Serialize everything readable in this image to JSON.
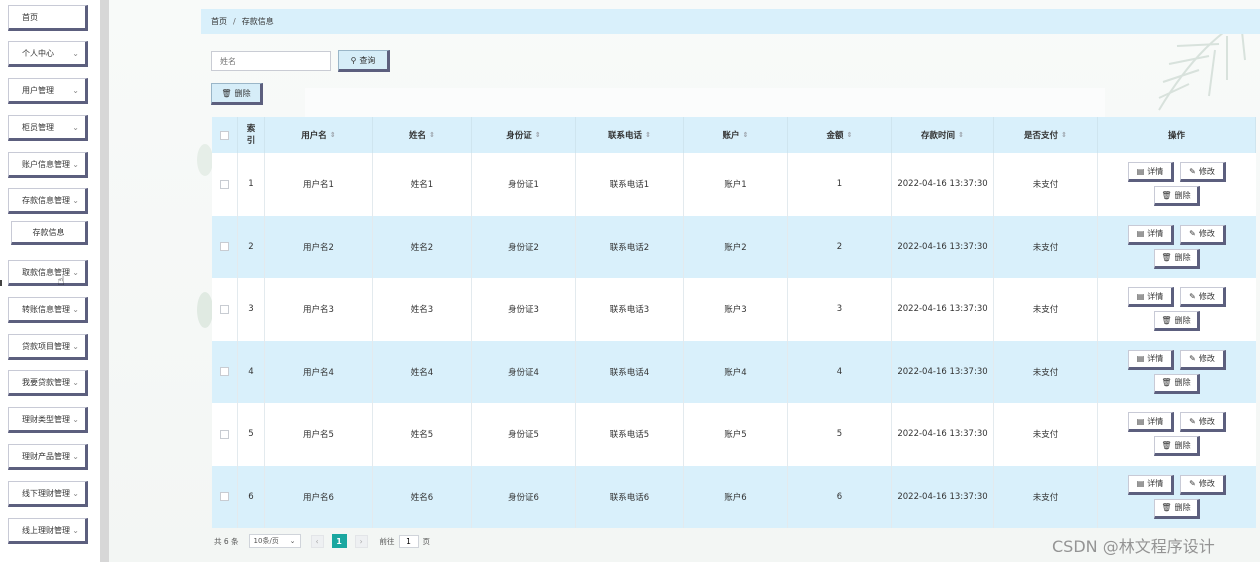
{
  "sidebar": {
    "items": [
      {
        "label": "首页",
        "chevron": false
      },
      {
        "label": "个人中心",
        "chevron": true
      },
      {
        "label": "用户管理",
        "chevron": true
      },
      {
        "label": "柜员管理",
        "chevron": true
      },
      {
        "label": "账户信息管理",
        "chevron": true
      },
      {
        "label": "存款信息管理",
        "chevron": true
      },
      {
        "label": "取款信息管理",
        "chevron": true
      },
      {
        "label": "转账信息管理",
        "chevron": true
      },
      {
        "label": "贷款项目管理",
        "chevron": true
      },
      {
        "label": "我要贷款管理",
        "chevron": true
      },
      {
        "label": "理财类型管理",
        "chevron": true
      },
      {
        "label": "理财产品管理",
        "chevron": true
      },
      {
        "label": "线下理财管理",
        "chevron": true
      },
      {
        "label": "线上理财管理",
        "chevron": true
      }
    ],
    "sub_item": "存款信息"
  },
  "breadcrumb": {
    "home": "首页",
    "separator": "/",
    "current": "存款信息"
  },
  "search": {
    "placeholder": "姓名",
    "button_label": "查询"
  },
  "toolbar": {
    "delete_label": "删除"
  },
  "table": {
    "columns": [
      "索引",
      "用户名",
      "姓名",
      "身份证",
      "联系电话",
      "账户",
      "金额",
      "存款时间",
      "是否支付",
      "操作"
    ],
    "rows": [
      {
        "index": "1",
        "username": "用户名1",
        "name": "姓名1",
        "id_card": "身份证1",
        "phone": "联系电话1",
        "account": "账户1",
        "amount": "1",
        "time": "2022-04-16 13:37:30",
        "paid": "未支付"
      },
      {
        "index": "2",
        "username": "用户名2",
        "name": "姓名2",
        "id_card": "身份证2",
        "phone": "联系电话2",
        "account": "账户2",
        "amount": "2",
        "time": "2022-04-16 13:37:30",
        "paid": "未支付"
      },
      {
        "index": "3",
        "username": "用户名3",
        "name": "姓名3",
        "id_card": "身份证3",
        "phone": "联系电话3",
        "account": "账户3",
        "amount": "3",
        "time": "2022-04-16 13:37:30",
        "paid": "未支付"
      },
      {
        "index": "4",
        "username": "用户名4",
        "name": "姓名4",
        "id_card": "身份证4",
        "phone": "联系电话4",
        "account": "账户4",
        "amount": "4",
        "time": "2022-04-16 13:37:30",
        "paid": "未支付"
      },
      {
        "index": "5",
        "username": "用户名5",
        "name": "姓名5",
        "id_card": "身份证5",
        "phone": "联系电话5",
        "account": "账户5",
        "amount": "5",
        "time": "2022-04-16 13:37:30",
        "paid": "未支付"
      },
      {
        "index": "6",
        "username": "用户名6",
        "name": "姓名6",
        "id_card": "身份证6",
        "phone": "联系电话6",
        "account": "账户6",
        "amount": "6",
        "time": "2022-04-16 13:37:30",
        "paid": "未支付"
      }
    ],
    "actions": {
      "detail": "详情",
      "edit": "修改",
      "delete": "删除"
    }
  },
  "pagination": {
    "total_text": "共 6 条",
    "page_size": "10条/页",
    "current_page": "1",
    "goto_label": "前往",
    "goto_value": "1",
    "page_suffix": "页"
  },
  "watermark": "CSDN @林文程序设计",
  "colors": {
    "header_bg": "#d9f0fb",
    "stripe_bg": "#d9f0fb",
    "button_shadow": "#5c5f7e",
    "page_active": "#1aa7a0"
  }
}
